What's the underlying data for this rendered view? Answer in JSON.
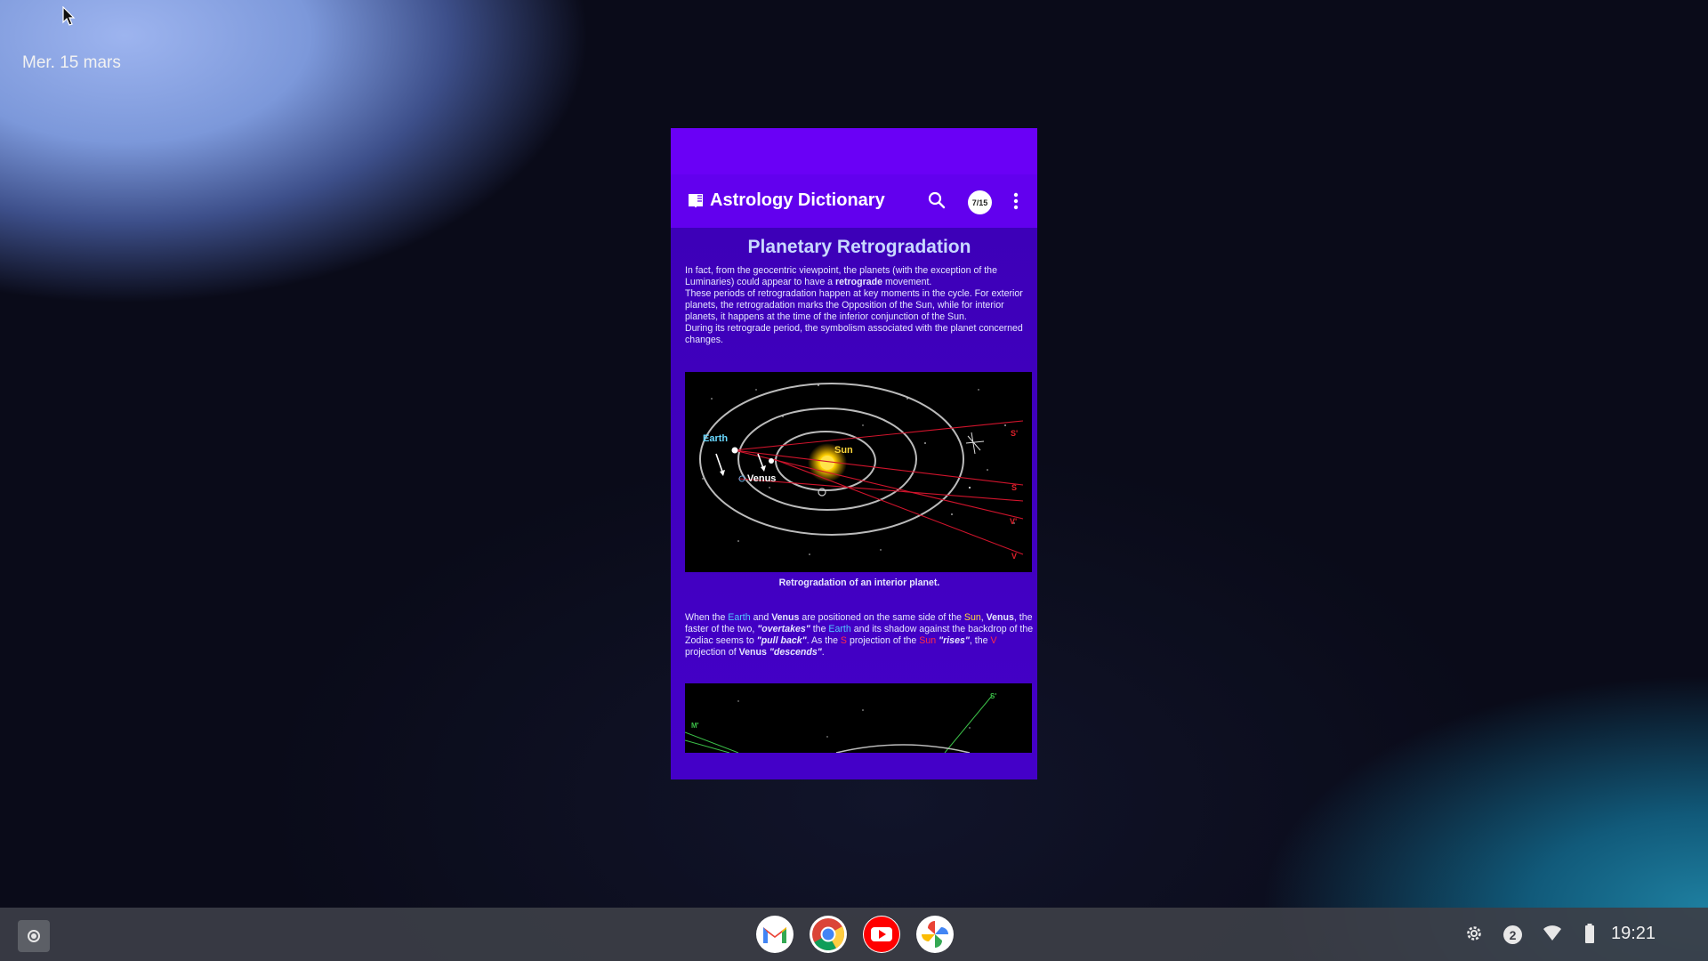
{
  "desktop": {
    "date": "Mer. 15 mars"
  },
  "app": {
    "title": "Astrology Dictionary",
    "counter": "7/15",
    "icons": {
      "title_icon": "book-icon",
      "search": "search-icon",
      "menu": "more-vert-icon"
    },
    "colors": {
      "toolbar": "#6200ee",
      "content": "#4400c8",
      "title_text": "#c9d8ff"
    }
  },
  "article": {
    "heading": "Planetary Retrogradation",
    "intro": {
      "part1": "In fact, from the geocentric viewpoint, the planets (with the exception of the Luminaries) could appear to have a ",
      "bold": "retrograde",
      "part2": " movement.",
      "line2": "These periods of retrogradation happen at key moments in the cycle. For exterior planets, the retrogradation marks the Opposition of the Sun, while for interior planets, it happens at the time of the inferior conjunction of the Sun.",
      "line3": "During its retrograde period, the symbolism associated with the planet concerned changes."
    },
    "figure1": {
      "caption": "Retrogradation of an interior planet.",
      "labels": {
        "earth": "Earth",
        "sun": "Sun",
        "venus": "Venus",
        "s_prime": "S'",
        "s": "S",
        "v_prime": "V'",
        "v": "V"
      }
    },
    "para2": {
      "t1": "When the ",
      "earth": "Earth",
      "t2": " and ",
      "venus": "Venus",
      "t3": " are positioned on the same side of the ",
      "sun": "Sun",
      "t4": ", ",
      "venus2": "Venus",
      "t5": ", the faster of the two, ",
      "overtakes": "\"overtakes\"",
      "t6": " the ",
      "earth2": "Earth",
      "t7": " and its shadow against the backdrop of the Zodiac seems to ",
      "pullback": "\"pull back\"",
      "t8": ". As the ",
      "s_label": "S",
      "t9": " projection of the ",
      "sun2": "Sun",
      "t10": " ",
      "rises": "\"rises\"",
      "t11": ", the ",
      "v_label": "V",
      "t12": " projection of ",
      "venus3": "Venus",
      "t13": " ",
      "descends": "\"descends\"",
      "t14": "."
    },
    "figure2": {
      "labels": {
        "s_prime": "S'",
        "m_prime": "M'"
      }
    }
  },
  "taskbar": {
    "apps": [
      {
        "name": "Gmail",
        "icon": "gmail-icon"
      },
      {
        "name": "Chrome",
        "icon": "chrome-icon"
      },
      {
        "name": "YouTube",
        "icon": "youtube-icon"
      },
      {
        "name": "Photos",
        "icon": "photos-icon"
      }
    ],
    "notification_count": "2",
    "clock": "19:21"
  }
}
